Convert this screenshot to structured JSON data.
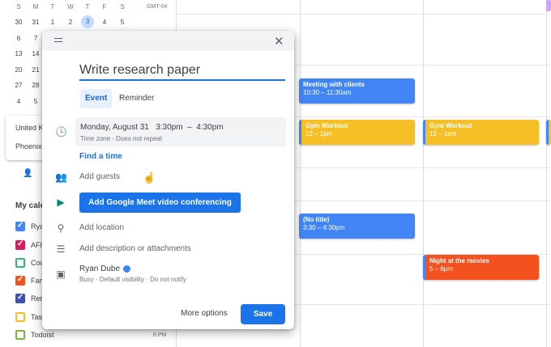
{
  "mini_calendar": {
    "days_of_week": [
      "S",
      "M",
      "T",
      "W",
      "T",
      "F",
      "S"
    ],
    "timezone_label": "GMT-04",
    "rows": [
      [
        "30",
        "31",
        "1",
        "2",
        "3",
        "4",
        "5"
      ],
      [
        "6",
        "7"
      ],
      [
        "13",
        "14"
      ],
      [
        "20",
        "21"
      ],
      [
        "27",
        "28"
      ],
      [
        "4",
        "5"
      ]
    ],
    "today": "3"
  },
  "timezone_popup": {
    "line1": "United K",
    "line2": "Phoenix"
  },
  "sidebar": {
    "search_people": "",
    "my_calendars_label": "My cale",
    "time_label": "8 PM",
    "calendars": [
      {
        "label": "Rya",
        "color": "#4285f4",
        "checked": true
      },
      {
        "label": "AFI",
        "color": "#d81b60",
        "checked": true
      },
      {
        "label": "Cou",
        "color": "#33b679",
        "checked": false
      },
      {
        "label": "Fan",
        "color": "#f4511e",
        "checked": true
      },
      {
        "label": "Rer",
        "color": "#3f51b5",
        "checked": true
      },
      {
        "label": "Tas",
        "color": "#f6bf26",
        "checked": false
      },
      {
        "label": "Todoist",
        "color": "#7cb342",
        "checked": false
      }
    ]
  },
  "events": [
    {
      "title": "Meeting with clients",
      "time": "10:30 – 11:30am",
      "kind": "blue"
    },
    {
      "title": "Gym Workout",
      "time": "12 – 1pm",
      "kind": "yellow"
    },
    {
      "title": "Gym Workout",
      "time": "12 – 1pm",
      "kind": "yellow"
    },
    {
      "title": "(No title)",
      "time": "3:30 – 4:30pm",
      "kind": "blue"
    },
    {
      "title": "Night at the movies",
      "time": "5 – 6pm",
      "kind": "orange"
    }
  ],
  "dialog": {
    "title": "Write research paper",
    "tabs": {
      "event": "Event",
      "reminder": "Reminder"
    },
    "date_line": "Monday, August 31   3:30pm  –  4:30pm",
    "sub_line": "Time zone · Does not repeat",
    "find_time": "Find a time",
    "add_guests": "Add guests",
    "meet_button": "Add Google Meet video conferencing",
    "add_location": "Add location",
    "add_description": "Add description or attachments",
    "owner": "Ryan Dube",
    "owner_sub": "Busy · Default visibility · Do not notify",
    "more_options": "More options",
    "save": "Save",
    "close_icon": "close-icon"
  }
}
